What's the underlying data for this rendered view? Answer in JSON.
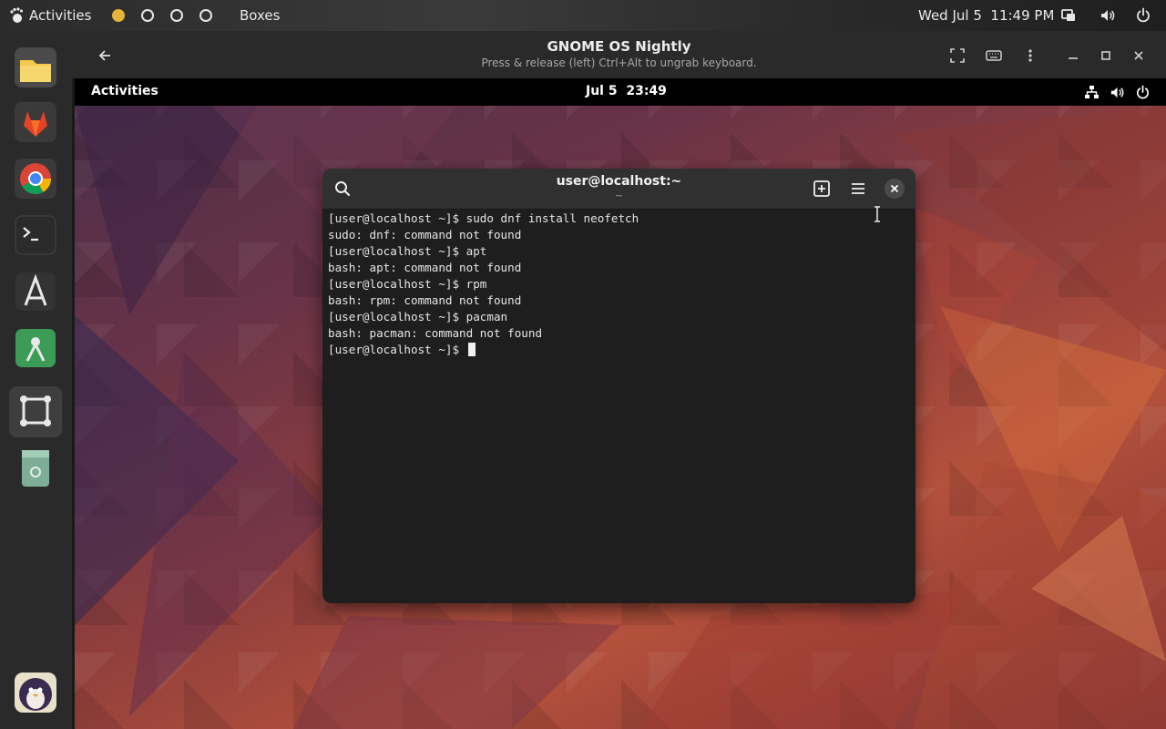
{
  "host_topbar": {
    "activities": "Activities",
    "app_name": "Boxes",
    "clock": "Wed Jul 5  11:49 PM",
    "workspace_count": 4,
    "active_workspace": 1
  },
  "dock": {
    "apps": [
      {
        "name": "files",
        "color": "#f2c94c"
      },
      {
        "name": "gitlab",
        "color": "#e24329"
      },
      {
        "name": "chrome",
        "color": "#4285f4"
      },
      {
        "name": "terminal",
        "color": "#2d2d2d"
      },
      {
        "name": "software",
        "color": "#3d3d3d"
      },
      {
        "name": "builder",
        "color": "#3a9c56"
      },
      {
        "name": "boxes",
        "color": "#3e3e3e",
        "active": true
      },
      {
        "name": "trash",
        "color": "#7fae96"
      },
      {
        "name": "penguin-app",
        "color": "#e8e0c8"
      }
    ]
  },
  "boxes_header": {
    "title": "GNOME OS Nightly",
    "subtitle": "Press & release (left) Ctrl+Alt to ungrab keyboard."
  },
  "guest_topbar": {
    "activities": "Activities",
    "clock": "Jul 5  23:49"
  },
  "terminal": {
    "title": "user@localhost:~",
    "subtitle": "~",
    "lines": [
      "[user@localhost ~]$ sudo dnf install neofetch",
      "sudo: dnf: command not found",
      "[user@localhost ~]$ apt",
      "bash: apt: command not found",
      "[user@localhost ~]$ rpm",
      "bash: rpm: command not found",
      "[user@localhost ~]$ pacman",
      "bash: pacman: command not found"
    ],
    "prompt": "[user@localhost ~]$ "
  },
  "colors": {
    "accent_workspace": "#e5b53a",
    "terminal_bg": "#1e1e1e",
    "terminal_header": "#303030"
  }
}
